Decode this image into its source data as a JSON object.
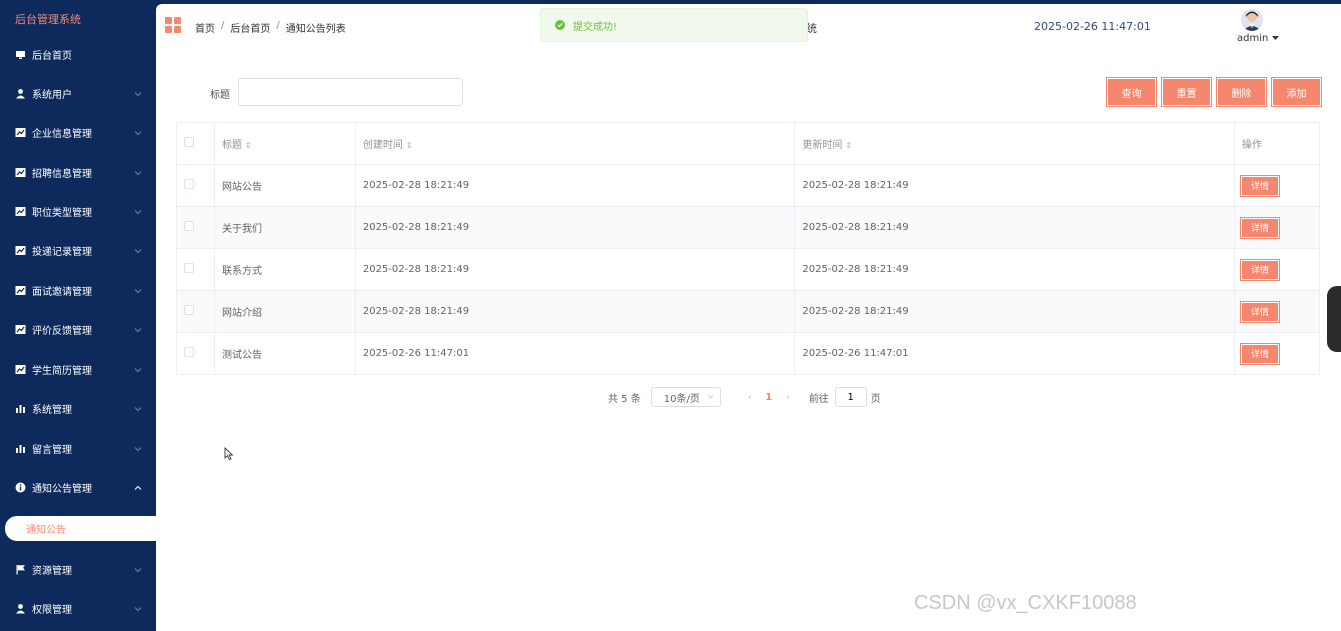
{
  "app": {
    "title": "后台管理系统"
  },
  "sidebar": {
    "items": [
      {
        "label": "后台首页",
        "icon": "monitor-icon",
        "has_chevron": false
      },
      {
        "label": "系统用户",
        "icon": "user-icon",
        "has_chevron": true
      },
      {
        "label": "企业信息管理",
        "icon": "chart-icon",
        "has_chevron": true
      },
      {
        "label": "招聘信息管理",
        "icon": "chart-icon",
        "has_chevron": true
      },
      {
        "label": "职位类型管理",
        "icon": "chart-icon",
        "has_chevron": true
      },
      {
        "label": "投递记录管理",
        "icon": "chart-icon",
        "has_chevron": true
      },
      {
        "label": "面试邀请管理",
        "icon": "chart-icon",
        "has_chevron": true
      },
      {
        "label": "评价反馈管理",
        "icon": "chart-icon",
        "has_chevron": true
      },
      {
        "label": "学生简历管理",
        "icon": "chart-icon",
        "has_chevron": true
      },
      {
        "label": "系统管理",
        "icon": "bar-chart-icon",
        "has_chevron": true
      },
      {
        "label": "留言管理",
        "icon": "bar-chart-icon",
        "has_chevron": true
      },
      {
        "label": "通知公告管理",
        "icon": "info-icon",
        "has_chevron": true,
        "expanded": true
      },
      {
        "label": "资源管理",
        "icon": "flag-icon",
        "has_chevron": true
      },
      {
        "label": "权限管理",
        "icon": "user-icon",
        "has_chevron": true
      }
    ],
    "active_sub": "通知公告"
  },
  "header": {
    "breadcrumb": [
      "首页",
      "后台首页",
      "通知公告列表"
    ],
    "separator": "/",
    "title_suffix": "统",
    "datetime": "2025-02-26 11:47:01",
    "user": "admin"
  },
  "toast": {
    "message": "提交成功!",
    "type": "success"
  },
  "search": {
    "label": "标题",
    "value": "",
    "placeholder": ""
  },
  "actions": {
    "query": "查询",
    "reset": "重置",
    "delete": "删除",
    "add": "添加"
  },
  "table": {
    "headers": {
      "title": "标题",
      "created": "创建时间",
      "updated": "更新时间",
      "ops": "操作"
    },
    "rows": [
      {
        "title": "网站公告",
        "created": "2025-02-28 18:21:49",
        "updated": "2025-02-28 18:21:49",
        "action": "详情"
      },
      {
        "title": "关于我们",
        "created": "2025-02-28 18:21:49",
        "updated": "2025-02-28 18:21:49",
        "action": "详情"
      },
      {
        "title": "联系方式",
        "created": "2025-02-28 18:21:49",
        "updated": "2025-02-28 18:21:49",
        "action": "详情"
      },
      {
        "title": "网站介绍",
        "created": "2025-02-28 18:21:49",
        "updated": "2025-02-28 18:21:49",
        "action": "详情"
      },
      {
        "title": "测试公告",
        "created": "2025-02-26 11:47:01",
        "updated": "2025-02-26 11:47:01",
        "action": "详情"
      }
    ]
  },
  "pagination": {
    "total": "共 5 条",
    "page_size": "10条/页",
    "prev": "‹",
    "current": "1",
    "next": "›",
    "goto_label": "前往",
    "goto_value": "1",
    "page_suffix": "页"
  },
  "watermark": "CSDN @vx_CXKF10088",
  "colors": {
    "sidebar_bg": "#0e2a5c",
    "accent": "#f5876f",
    "brand": "#f28b7a",
    "success": "#67c23a"
  }
}
